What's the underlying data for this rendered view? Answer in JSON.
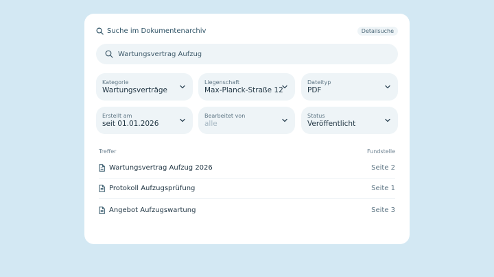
{
  "header": {
    "title": "Suche im Dokumentenarchiv",
    "detail_button": "Detailsuche"
  },
  "search": {
    "query": "Wartungsvertrag Aufzug"
  },
  "filters": [
    {
      "label": "Kategorie",
      "value": "Wartungsverträge",
      "placeholder": false
    },
    {
      "label": "Liegenschaft",
      "value": "Max-Planck-Straße 12",
      "placeholder": false
    },
    {
      "label": "Dateityp",
      "value": "PDF",
      "placeholder": false
    },
    {
      "label": "Erstellt am",
      "value": "seit 01.01.2026",
      "placeholder": false
    },
    {
      "label": "Bearbeitet von",
      "value": "alle",
      "placeholder": true
    },
    {
      "label": "Status",
      "value": "Veröffentlicht",
      "placeholder": false
    }
  ],
  "results": {
    "col_hit": "Treffer",
    "col_location": "Fundstelle",
    "items": [
      {
        "title": "Wartungsvertrag Aufzug 2026",
        "location": "Seite 2",
        "icon": "document-icon"
      },
      {
        "title": "Protokoll Aufzugsprüfung",
        "location": "Seite 1",
        "icon": "document-icon"
      },
      {
        "title": "Angebot Aufzugswartung",
        "location": "Seite 3",
        "icon": "document-icon"
      }
    ]
  },
  "colors": {
    "page_background": "#d3e8f3",
    "card_background": "#ffffff",
    "field_background": "#eef4f7",
    "accent": "#2f5366"
  }
}
